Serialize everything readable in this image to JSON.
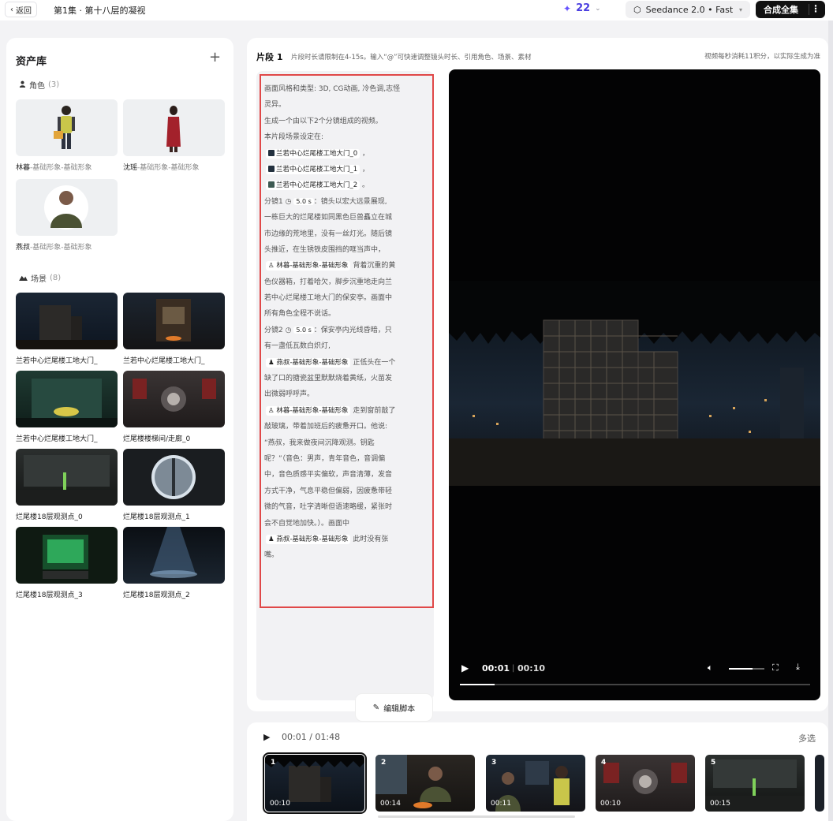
{
  "topbar": {
    "back_label": "返回",
    "episode_title": "第1集 · 第十八层的凝视",
    "credits": "22",
    "model": "Seedance 2.0 • Fast",
    "compose_label": "合成全集"
  },
  "assets": {
    "title": "资产库",
    "characters_label": "角色",
    "characters_count": "(3)",
    "characters": [
      {
        "name": "林暮",
        "sub": "-基础形象-基础形象"
      },
      {
        "name": "沈瑶",
        "sub": "-基础形象-基础形象"
      },
      {
        "name": "燕叔",
        "sub": "-基础形象-基础形象"
      }
    ],
    "scenes_label": "场景",
    "scenes_count": "(8)",
    "scenes": [
      {
        "name": "兰若中心烂尾楼工地大门_"
      },
      {
        "name": "兰若中心烂尾楼工地大门_"
      },
      {
        "name": "兰若中心烂尾楼工地大门_"
      },
      {
        "name": "烂尾楼楼梯间/走廊_0"
      },
      {
        "name": "烂尾楼18层观测点_0"
      },
      {
        "name": "烂尾楼18层观测点_1"
      },
      {
        "name": "烂尾楼18层观测点_3"
      },
      {
        "name": "烂尾楼18层观测点_2"
      }
    ]
  },
  "segment": {
    "name": "片段 1",
    "hint": "片段时长请限制在4-15s。输入“@”可快速调整镜头时长、引用角色、场景、素材",
    "cost": "视频每秒消耗11积分，以实际生成为准",
    "script": {
      "l1": "画面风格和类型: 3D, CG动画, 冷色调,志怪",
      "l2": "灵异。",
      "l3": "生成一个由以下2个分镜组成的视频。",
      "l4": "本片段场景设定在:",
      "scene_ref_0": "兰若中心烂尾楼工地大门_0",
      "scene_ref_1": "兰若中心烂尾楼工地大门_1",
      "scene_ref_2": "兰若中心烂尾楼工地大门_2",
      "sep_comma": "，",
      "sep_period": "。",
      "shot1_label": "分镜1",
      "shot1_dur": "5.0 s",
      "shot1_a": "：镜头以宏大远景展现,",
      "shot1_b": "一栋巨大的烂尾楼如同黑色巨兽矗立在城",
      "shot1_c": "市边缘的荒地里，没有一丝灯光。随后镜",
      "shot1_d": "头推近，在生锈铁皮围挡的哐当声中，",
      "char_lin": "林暮-基础形象-基础形象",
      "shot1_e": "背着沉重的黄",
      "shot1_f": "色仪器箱，打着哈欠，脚步沉重地走向兰",
      "shot1_g": "若中心烂尾楼工地大门的保安亭。画面中",
      "shot1_h": "所有角色全程不说话。",
      "shot2_label": "分镜2",
      "shot2_dur": "5.0 s",
      "shot2_a": "：保安亭内光线昏暗，只",
      "shot2_b": "有一盏低瓦数白炽灯,",
      "char_yan": "燕叔-基础形象-基础形象",
      "shot2_c": "正低头在一个",
      "shot2_d": "缺了口的搪瓷盆里默默烧着黄纸，火苗发",
      "shot2_e": "出微弱呼呼声。",
      "shot2_f": "走到窗前敲了",
      "shot2_g": "敲玻璃，带着加班后的疲惫开口。他说:",
      "shot2_h": "“燕叔，我来做夜间沉降观测。钥匙",
      "shot2_i": "呢？”（音色：男声，青年音色，音调偏",
      "shot2_j": "中，音色质感平实偏软，声音清薄，发音",
      "shot2_k": "方式干净，气息平稳但偏弱，因疲惫带轻",
      "shot2_l": "微的气音，吐字清晰但语速略缓，紧张时",
      "shot2_m": "会不自觉地加快。）。画面中",
      "shot2_n": "此时没有张",
      "shot2_o": "嘴。"
    },
    "edit_label": "编辑脚本",
    "player": {
      "current": "00:01",
      "total": "00:10",
      "progress": 0.1,
      "volume": 0.67
    }
  },
  "timeline": {
    "time": "00:01 / 01:48",
    "multi_select": "多选",
    "clips": [
      {
        "num": "1",
        "dur": "00:10"
      },
      {
        "num": "2",
        "dur": "00:14"
      },
      {
        "num": "3",
        "dur": "00:11"
      },
      {
        "num": "4",
        "dur": "00:10"
      },
      {
        "num": "5",
        "dur": "00:15"
      }
    ]
  }
}
